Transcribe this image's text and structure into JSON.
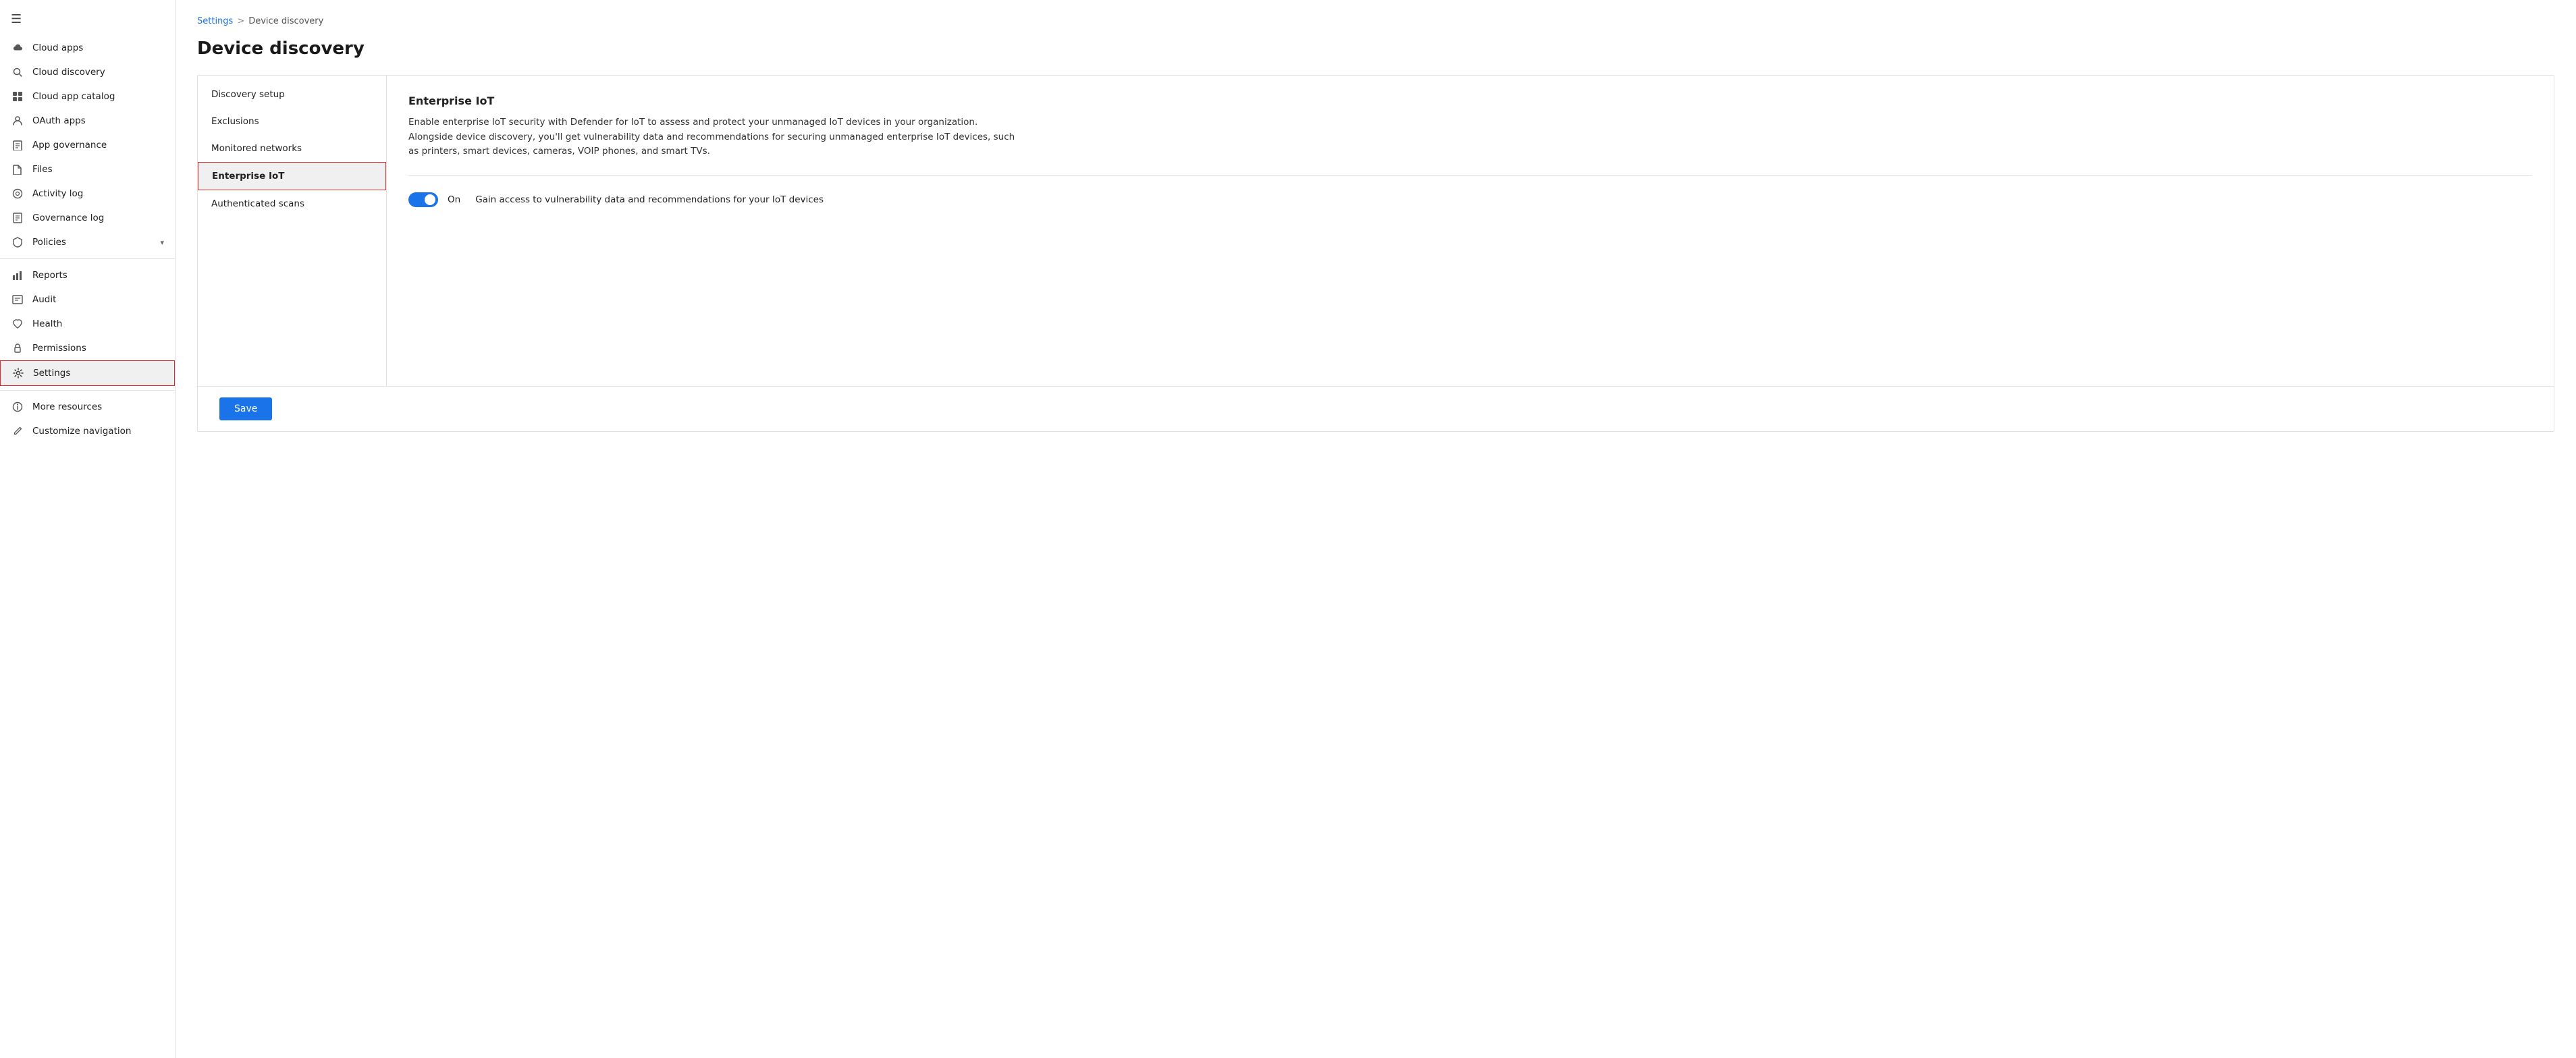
{
  "sidebar": {
    "hamburger": "☰",
    "items": [
      {
        "id": "cloud-apps",
        "label": "Cloud apps",
        "icon": "☁",
        "active": false
      },
      {
        "id": "cloud-discovery",
        "label": "Cloud discovery",
        "icon": "🔍",
        "active": false
      },
      {
        "id": "cloud-app-catalog",
        "label": "Cloud app catalog",
        "icon": "⊞",
        "active": false
      },
      {
        "id": "oauth-apps",
        "label": "OAuth apps",
        "icon": "🔑",
        "active": false
      },
      {
        "id": "app-governance",
        "label": "App governance",
        "icon": "📋",
        "active": false
      },
      {
        "id": "files",
        "label": "Files",
        "icon": "📁",
        "active": false
      },
      {
        "id": "activity-log",
        "label": "Activity log",
        "icon": "👁",
        "active": false
      },
      {
        "id": "governance-log",
        "label": "Governance log",
        "icon": "📄",
        "active": false
      },
      {
        "id": "policies",
        "label": "Policies",
        "icon": "🛡",
        "active": false,
        "hasChevron": true
      },
      {
        "id": "reports",
        "label": "Reports",
        "icon": "📊",
        "active": false
      },
      {
        "id": "audit",
        "label": "Audit",
        "icon": "📑",
        "active": false
      },
      {
        "id": "health",
        "label": "Health",
        "icon": "♡",
        "active": false
      },
      {
        "id": "permissions",
        "label": "Permissions",
        "icon": "🔐",
        "active": false
      },
      {
        "id": "settings",
        "label": "Settings",
        "icon": "⚙",
        "active": true
      }
    ],
    "bottom_items": [
      {
        "id": "more-resources",
        "label": "More resources",
        "icon": "ℹ"
      },
      {
        "id": "customize-navigation",
        "label": "Customize navigation",
        "icon": "✏"
      }
    ]
  },
  "breadcrumb": {
    "parent": "Settings",
    "separator": ">",
    "current": "Device discovery"
  },
  "page": {
    "title": "Device discovery"
  },
  "panel_nav": {
    "items": [
      {
        "id": "discovery-setup",
        "label": "Discovery setup",
        "active": false
      },
      {
        "id": "exclusions",
        "label": "Exclusions",
        "active": false
      },
      {
        "id": "monitored-networks",
        "label": "Monitored networks",
        "active": false
      },
      {
        "id": "enterprise-iot",
        "label": "Enterprise IoT",
        "active": true
      },
      {
        "id": "authenticated-scans",
        "label": "Authenticated scans",
        "active": false
      }
    ]
  },
  "enterprise_iot": {
    "title": "Enterprise IoT",
    "description": "Enable enterprise IoT security with Defender for IoT to assess and protect your unmanaged IoT devices in your organization. Alongside device discovery, you'll get vulnerability data and recommendations for securing unmanaged enterprise IoT devices, such as printers, smart devices, cameras, VOIP phones, and smart TVs.",
    "toggle": {
      "state": "on",
      "label": "On",
      "description": "Gain access to vulnerability data and recommendations for your IoT devices"
    }
  },
  "footer": {
    "save_label": "Save"
  }
}
